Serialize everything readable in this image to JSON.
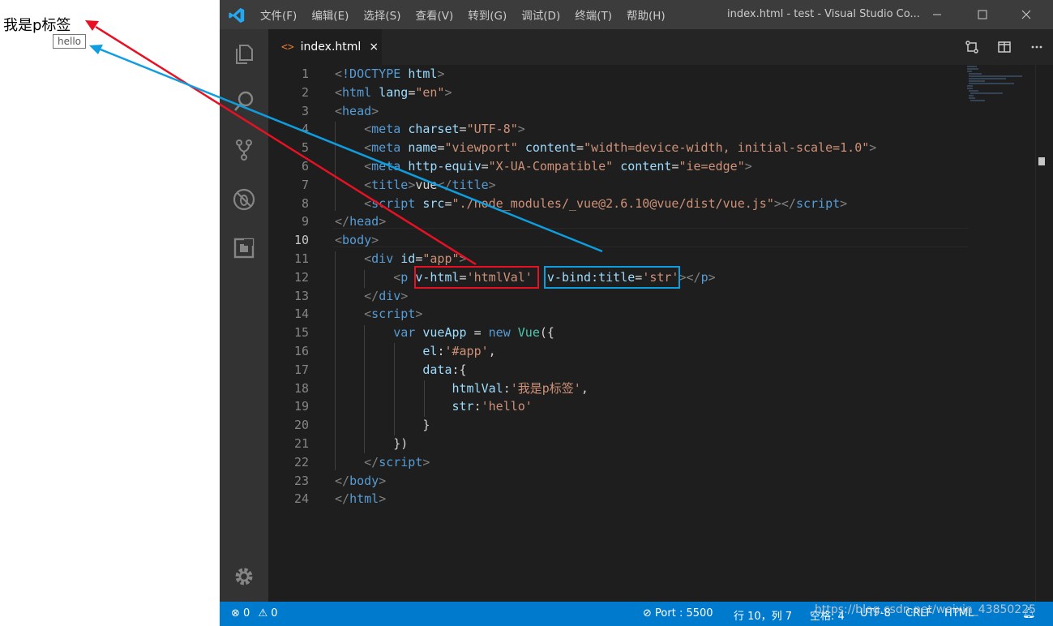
{
  "preview": {
    "text": "我是p标签",
    "tooltip": "hello"
  },
  "titlebar": {
    "menu": [
      "文件(F)",
      "编辑(E)",
      "选择(S)",
      "查看(V)",
      "转到(G)",
      "调试(D)",
      "终端(T)",
      "帮助(H)"
    ],
    "window_title": "index.html - test - Visual Studio Co..."
  },
  "tab": {
    "icon": "<>",
    "label": "index.html",
    "close": "×"
  },
  "editor": {
    "current_line": 10,
    "lines": [
      {
        "n": "1",
        "parts": [
          [
            "p",
            "<"
          ],
          [
            "tag",
            "!DOCTYPE"
          ],
          [
            "txt",
            " "
          ],
          [
            "attr",
            "html"
          ],
          [
            "p",
            ">"
          ]
        ]
      },
      {
        "n": "2",
        "parts": [
          [
            "p",
            "<"
          ],
          [
            "tag",
            "html"
          ],
          [
            "txt",
            " "
          ],
          [
            "attr",
            "lang"
          ],
          [
            "txt",
            "="
          ],
          [
            "str",
            "\"en\""
          ],
          [
            "p",
            ">"
          ]
        ]
      },
      {
        "n": "3",
        "parts": [
          [
            "p",
            "<"
          ],
          [
            "tag",
            "head"
          ],
          [
            "p",
            ">"
          ]
        ]
      },
      {
        "n": "4",
        "parts": [
          [
            "txt",
            "    "
          ],
          [
            "p",
            "<"
          ],
          [
            "tag",
            "meta"
          ],
          [
            "txt",
            " "
          ],
          [
            "attr",
            "charset"
          ],
          [
            "txt",
            "="
          ],
          [
            "str",
            "\"UTF-8\""
          ],
          [
            "p",
            ">"
          ]
        ]
      },
      {
        "n": "5",
        "parts": [
          [
            "txt",
            "    "
          ],
          [
            "p",
            "<"
          ],
          [
            "tag",
            "meta"
          ],
          [
            "txt",
            " "
          ],
          [
            "attr",
            "name"
          ],
          [
            "txt",
            "="
          ],
          [
            "str",
            "\"viewport\""
          ],
          [
            "txt",
            " "
          ],
          [
            "attr",
            "content"
          ],
          [
            "txt",
            "="
          ],
          [
            "str",
            "\"width=device-width, initial-scale=1.0\""
          ],
          [
            "p",
            ">"
          ]
        ]
      },
      {
        "n": "6",
        "parts": [
          [
            "txt",
            "    "
          ],
          [
            "p",
            "<"
          ],
          [
            "tag",
            "meta"
          ],
          [
            "txt",
            " "
          ],
          [
            "attr",
            "http-equiv"
          ],
          [
            "txt",
            "="
          ],
          [
            "str",
            "\"X-UA-Compatible\""
          ],
          [
            "txt",
            " "
          ],
          [
            "attr",
            "content"
          ],
          [
            "txt",
            "="
          ],
          [
            "str",
            "\"ie=edge\""
          ],
          [
            "p",
            ">"
          ]
        ]
      },
      {
        "n": "7",
        "parts": [
          [
            "txt",
            "    "
          ],
          [
            "p",
            "<"
          ],
          [
            "tag",
            "title"
          ],
          [
            "p",
            ">"
          ],
          [
            "txt",
            "vue"
          ],
          [
            "p",
            "</"
          ],
          [
            "tag",
            "title"
          ],
          [
            "p",
            ">"
          ]
        ]
      },
      {
        "n": "8",
        "parts": [
          [
            "txt",
            "    "
          ],
          [
            "p",
            "<"
          ],
          [
            "tag",
            "script"
          ],
          [
            "txt",
            " "
          ],
          [
            "attr",
            "src"
          ],
          [
            "txt",
            "="
          ],
          [
            "str",
            "\"./node_modules/_vue@2.6.10@vue/dist/vue.js\""
          ],
          [
            "p",
            "></"
          ],
          [
            "tag",
            "script"
          ],
          [
            "p",
            ">"
          ]
        ]
      },
      {
        "n": "9",
        "parts": [
          [
            "p",
            "</"
          ],
          [
            "tag",
            "head"
          ],
          [
            "p",
            ">"
          ]
        ]
      },
      {
        "n": "10",
        "parts": [
          [
            "p",
            "<"
          ],
          [
            "tag",
            "body"
          ],
          [
            "p",
            ">"
          ]
        ]
      },
      {
        "n": "11",
        "parts": [
          [
            "txt",
            "    "
          ],
          [
            "p",
            "<"
          ],
          [
            "tag",
            "div"
          ],
          [
            "txt",
            " "
          ],
          [
            "attr",
            "id"
          ],
          [
            "txt",
            "="
          ],
          [
            "str",
            "\"app\""
          ],
          [
            "p",
            ">"
          ]
        ]
      },
      {
        "n": "12",
        "parts": [
          [
            "txt",
            "        "
          ],
          [
            "p",
            "<"
          ],
          [
            "tag",
            "p"
          ],
          [
            "txt",
            " "
          ],
          [
            "attr",
            "v-html"
          ],
          [
            "txt",
            "="
          ],
          [
            "str",
            "'htmlVal'"
          ],
          [
            "txt",
            "  "
          ],
          [
            "attr",
            "v-bind:title"
          ],
          [
            "txt",
            "="
          ],
          [
            "str",
            "'str'"
          ],
          [
            "p",
            "></"
          ],
          [
            "tag",
            "p"
          ],
          [
            "p",
            ">"
          ]
        ]
      },
      {
        "n": "13",
        "parts": [
          [
            "txt",
            "    "
          ],
          [
            "p",
            "</"
          ],
          [
            "tag",
            "div"
          ],
          [
            "p",
            ">"
          ]
        ]
      },
      {
        "n": "14",
        "parts": [
          [
            "txt",
            "    "
          ],
          [
            "p",
            "<"
          ],
          [
            "tag",
            "script"
          ],
          [
            "p",
            ">"
          ]
        ]
      },
      {
        "n": "15",
        "parts": [
          [
            "txt",
            "        "
          ],
          [
            "kw",
            "var"
          ],
          [
            "txt",
            " "
          ],
          [
            "attr",
            "vueApp"
          ],
          [
            "txt",
            " = "
          ],
          [
            "kw",
            "new"
          ],
          [
            "txt",
            " "
          ],
          [
            "cls",
            "Vue"
          ],
          [
            "txt",
            "({"
          ]
        ]
      },
      {
        "n": "16",
        "parts": [
          [
            "txt",
            "            "
          ],
          [
            "attr",
            "el"
          ],
          [
            "txt",
            ":"
          ],
          [
            "str",
            "'#app'"
          ],
          [
            "txt",
            ","
          ]
        ]
      },
      {
        "n": "17",
        "parts": [
          [
            "txt",
            "            "
          ],
          [
            "attr",
            "data"
          ],
          [
            "txt",
            ":{"
          ]
        ]
      },
      {
        "n": "18",
        "parts": [
          [
            "txt",
            "                "
          ],
          [
            "attr",
            "htmlVal"
          ],
          [
            "txt",
            ":"
          ],
          [
            "str",
            "'我是p标签'"
          ],
          [
            "txt",
            ","
          ]
        ]
      },
      {
        "n": "19",
        "parts": [
          [
            "txt",
            "                "
          ],
          [
            "attr",
            "str"
          ],
          [
            "txt",
            ":"
          ],
          [
            "str",
            "'hello'"
          ]
        ]
      },
      {
        "n": "20",
        "parts": [
          [
            "txt",
            "            }"
          ]
        ]
      },
      {
        "n": "21",
        "parts": [
          [
            "txt",
            "        })"
          ]
        ]
      },
      {
        "n": "22",
        "parts": [
          [
            "txt",
            "    "
          ],
          [
            "p",
            "</"
          ],
          [
            "tag",
            "script"
          ],
          [
            "p",
            ">"
          ]
        ]
      },
      {
        "n": "23",
        "parts": [
          [
            "p",
            "</"
          ],
          [
            "tag",
            "body"
          ],
          [
            "p",
            ">"
          ]
        ]
      },
      {
        "n": "24",
        "parts": [
          [
            "p",
            "</"
          ],
          [
            "tag",
            "html"
          ],
          [
            "p",
            ">"
          ]
        ]
      }
    ]
  },
  "statusbar": {
    "errors": "0",
    "warnings": "0",
    "port": "Port : 5500",
    "position": "行 10，列 7",
    "spaces": "空格: 4",
    "encoding": "UTF-8",
    "eol": "CRLF",
    "language": "HTML"
  },
  "watermark": "https://blog.csdn.net/weixin_43850225",
  "colors": {
    "annotation_red": "#e81123",
    "annotation_blue": "#0e9ee0",
    "statusbar": "#007acc",
    "titlebar": "#3c3c3c",
    "activitybar": "#333333"
  },
  "icons": [
    "vscode-logo-icon",
    "explorer-icon",
    "search-icon",
    "source-control-icon",
    "debug-icon",
    "extensions-icon",
    "settings-gear-icon",
    "minimize-icon",
    "maximize-icon",
    "close-icon",
    "compare-icon",
    "split-editor-icon",
    "more-actions-icon",
    "error-icon",
    "warning-icon",
    "live-server-icon",
    "notification-bell-icon"
  ]
}
